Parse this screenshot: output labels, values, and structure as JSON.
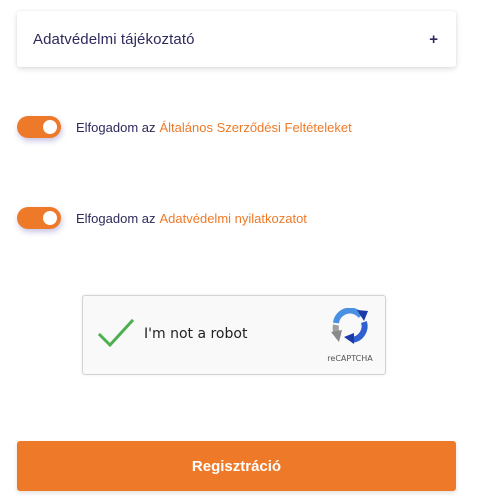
{
  "accordion": {
    "title": "Adatvédelmi tájékoztató",
    "expand_symbol": "+",
    "icon": "plus-icon"
  },
  "consents": [
    {
      "prefix": "Elfogadom az",
      "link_text": "Általános Szerződési Feltételeket",
      "checked": true
    },
    {
      "prefix": "Elfogadom az",
      "link_text": "Adatvédelmi nyilatkozatot",
      "checked": true
    }
  ],
  "recaptcha": {
    "label": "I'm not a robot",
    "brand": "reCAPTCHA",
    "checked": true,
    "icon": "recaptcha-logo-icon"
  },
  "submit": {
    "label": "Regisztráció"
  },
  "colors": {
    "accent": "#ee7a29",
    "text": "#2d2a5c",
    "check": "#4caf50"
  }
}
